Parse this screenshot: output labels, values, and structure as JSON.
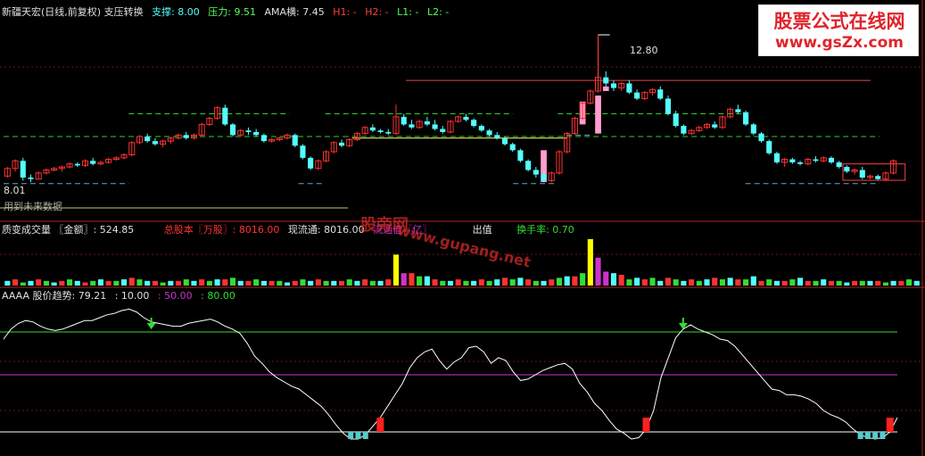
{
  "header1": {
    "title": "新疆天宏(日线,前复权) 支压转换",
    "support_label": "支撑: 8.00",
    "pressure_label": "压力: 9.51",
    "ama_label": "AMA横: 7.45",
    "h1_label": "H1: -",
    "h2_label": "H2: -",
    "l1_label": "L1: -",
    "l2_label": "L2: -"
  },
  "header2": {
    "title": "质变成交量 〖金额〗: 524.85",
    "total_shares": "总股本〖万股〗: 8016.00",
    "float_shares": "现流通: 8016.00",
    "float_value": "流通值〖亿〗",
    "chuzhi": "出值",
    "turnover": "换手率: 0.70"
  },
  "header3": {
    "title": "AAAA 股价趋势: 79.21",
    "l10": ": 10.00",
    "l50": ": 50.00",
    "l80": ": 80.00"
  },
  "price_labels": {
    "high": "12.80",
    "low": "8.01",
    "future": "用到未来数据"
  },
  "logo": {
    "line1": "股票公式在线网",
    "line2": "www.gsZx.com"
  },
  "watermark": {
    "cn": "股旁网",
    "url": "www.gupang.net"
  },
  "colors": {
    "up": "#ff3232",
    "down": "#54ffff",
    "support": "#33cc33",
    "pressure": "#3cb371",
    "level80": "#33dd33",
    "level50": "#cc33cc",
    "level10": "#ffffff",
    "trend": "#ffffff"
  },
  "chart_data": [
    {
      "type": "candlestick",
      "title": "新疆天宏(日线,前复权) 支压转换",
      "ylim": [
        7.6,
        13.3
      ],
      "ohlc": [
        [
          8.15,
          8.45,
          8.1,
          8.4
        ],
        [
          8.4,
          8.7,
          8.3,
          8.65
        ],
        [
          8.65,
          8.75,
          8.0,
          8.1
        ],
        [
          8.1,
          8.2,
          7.95,
          8.05
        ],
        [
          8.05,
          8.3,
          8.05,
          8.25
        ],
        [
          8.25,
          8.4,
          8.2,
          8.35
        ],
        [
          8.35,
          8.45,
          8.3,
          8.4
        ],
        [
          8.4,
          8.5,
          8.3,
          8.45
        ],
        [
          8.45,
          8.6,
          8.4,
          8.55
        ],
        [
          8.55,
          8.6,
          8.45,
          8.5
        ],
        [
          8.5,
          8.7,
          8.45,
          8.65
        ],
        [
          8.65,
          8.75,
          8.5,
          8.55
        ],
        [
          8.55,
          8.65,
          8.5,
          8.6
        ],
        [
          8.6,
          8.75,
          8.55,
          8.7
        ],
        [
          8.7,
          8.8,
          8.65,
          8.75
        ],
        [
          8.75,
          8.9,
          8.7,
          8.85
        ],
        [
          8.85,
          9.3,
          8.8,
          9.25
        ],
        [
          9.25,
          9.5,
          9.2,
          9.45
        ],
        [
          9.45,
          9.55,
          9.25,
          9.3
        ],
        [
          9.3,
          9.4,
          9.15,
          9.2
        ],
        [
          9.2,
          9.35,
          9.1,
          9.3
        ],
        [
          9.3,
          9.45,
          9.2,
          9.4
        ],
        [
          9.4,
          9.55,
          9.35,
          9.5
        ],
        [
          9.5,
          9.6,
          9.35,
          9.4
        ],
        [
          9.4,
          9.55,
          9.35,
          9.5
        ],
        [
          9.5,
          9.9,
          9.45,
          9.85
        ],
        [
          9.85,
          10.1,
          9.8,
          10.05
        ],
        [
          10.05,
          10.45,
          10.0,
          10.4
        ],
        [
          10.4,
          10.5,
          9.8,
          9.85
        ],
        [
          9.85,
          9.9,
          9.45,
          9.5
        ],
        [
          9.5,
          9.7,
          9.45,
          9.65
        ],
        [
          9.65,
          9.75,
          9.5,
          9.6
        ],
        [
          9.6,
          9.7,
          9.45,
          9.5
        ],
        [
          9.5,
          9.55,
          9.25,
          9.3
        ],
        [
          9.3,
          9.4,
          9.25,
          9.35
        ],
        [
          9.35,
          9.45,
          9.3,
          9.4
        ],
        [
          9.4,
          9.55,
          9.35,
          9.5
        ],
        [
          9.5,
          9.55,
          9.1,
          9.15
        ],
        [
          9.15,
          9.2,
          8.7,
          8.75
        ],
        [
          8.75,
          8.8,
          8.35,
          8.4
        ],
        [
          8.4,
          8.7,
          8.35,
          8.65
        ],
        [
          8.65,
          9.0,
          8.6,
          8.95
        ],
        [
          8.95,
          9.3,
          8.9,
          9.25
        ],
        [
          9.25,
          9.35,
          9.1,
          9.15
        ],
        [
          9.15,
          9.4,
          9.1,
          9.35
        ],
        [
          9.35,
          9.6,
          9.3,
          9.55
        ],
        [
          9.55,
          9.8,
          9.5,
          9.75
        ],
        [
          9.75,
          9.85,
          9.6,
          9.65
        ],
        [
          9.65,
          9.7,
          9.55,
          9.6
        ],
        [
          9.6,
          9.7,
          9.5,
          9.55
        ],
        [
          9.55,
          10.5,
          9.5,
          10.1
        ],
        [
          10.1,
          10.2,
          9.8,
          9.85
        ],
        [
          9.85,
          10.0,
          9.7,
          9.75
        ],
        [
          9.75,
          10.0,
          9.7,
          9.95
        ],
        [
          9.95,
          10.1,
          9.8,
          9.85
        ],
        [
          9.85,
          10.0,
          9.65,
          9.7
        ],
        [
          9.7,
          9.8,
          9.55,
          9.6
        ],
        [
          9.6,
          10.0,
          9.55,
          9.95
        ],
        [
          9.95,
          10.15,
          9.9,
          10.1
        ],
        [
          10.1,
          10.2,
          9.95,
          10.0
        ],
        [
          10.0,
          10.05,
          9.75,
          9.8
        ],
        [
          9.8,
          9.85,
          9.6,
          9.65
        ],
        [
          9.65,
          9.7,
          9.45,
          9.5
        ],
        [
          9.5,
          9.6,
          9.35,
          9.4
        ],
        [
          9.4,
          9.45,
          9.15,
          9.2
        ],
        [
          9.2,
          9.25,
          8.95,
          9.0
        ],
        [
          9.0,
          9.05,
          8.6,
          8.65
        ],
        [
          8.65,
          8.7,
          8.3,
          8.35
        ],
        [
          8.35,
          8.45,
          8.1,
          8.2
        ],
        [
          8.2,
          8.3,
          7.95,
          8.0
        ],
        [
          8.0,
          8.3,
          7.95,
          8.25
        ],
        [
          8.25,
          9.0,
          8.2,
          8.95
        ],
        [
          8.95,
          9.6,
          8.9,
          9.55
        ],
        [
          9.55,
          10.1,
          9.5,
          10.05
        ],
        [
          10.05,
          10.6,
          10.0,
          10.55
        ],
        [
          10.55,
          11.0,
          10.5,
          10.95
        ],
        [
          10.95,
          12.8,
          10.9,
          11.4
        ],
        [
          11.4,
          11.6,
          11.1,
          11.2
        ],
        [
          11.2,
          11.3,
          10.95,
          11.05
        ],
        [
          11.05,
          11.25,
          10.95,
          11.2
        ],
        [
          11.2,
          11.3,
          10.85,
          10.9
        ],
        [
          10.9,
          11.0,
          10.65,
          10.7
        ],
        [
          10.7,
          10.95,
          10.65,
          10.9
        ],
        [
          10.9,
          11.05,
          10.8,
          11.0
        ],
        [
          11.0,
          11.1,
          10.65,
          10.7
        ],
        [
          10.7,
          10.8,
          10.15,
          10.2
        ],
        [
          10.2,
          10.3,
          9.75,
          9.8
        ],
        [
          9.8,
          9.85,
          9.5,
          9.55
        ],
        [
          9.55,
          9.7,
          9.5,
          9.65
        ],
        [
          9.65,
          9.8,
          9.6,
          9.75
        ],
        [
          9.75,
          9.9,
          9.7,
          9.85
        ],
        [
          9.85,
          9.95,
          9.7,
          9.75
        ],
        [
          9.75,
          10.15,
          9.7,
          10.1
        ],
        [
          10.1,
          10.4,
          10.05,
          10.35
        ],
        [
          10.35,
          10.5,
          10.2,
          10.25
        ],
        [
          10.25,
          10.3,
          9.8,
          9.85
        ],
        [
          9.85,
          9.9,
          9.5,
          9.55
        ],
        [
          9.55,
          9.6,
          9.25,
          9.3
        ],
        [
          9.3,
          9.35,
          8.85,
          8.9
        ],
        [
          8.9,
          8.95,
          8.55,
          8.6
        ],
        [
          8.6,
          8.75,
          8.45,
          8.7
        ],
        [
          8.7,
          8.75,
          8.55,
          8.6
        ],
        [
          8.6,
          8.65,
          8.5,
          8.55
        ],
        [
          8.55,
          8.75,
          8.5,
          8.7
        ],
        [
          8.7,
          8.8,
          8.6,
          8.65
        ],
        [
          8.65,
          8.8,
          8.6,
          8.75
        ],
        [
          8.75,
          8.8,
          8.55,
          8.6
        ],
        [
          8.6,
          8.65,
          8.4,
          8.45
        ],
        [
          8.45,
          8.5,
          8.25,
          8.3
        ],
        [
          8.3,
          8.4,
          8.2,
          8.35
        ],
        [
          8.35,
          8.45,
          8.05,
          8.1
        ],
        [
          8.1,
          8.2,
          8.05,
          8.15
        ],
        [
          8.15,
          8.2,
          8.0,
          8.05
        ],
        [
          8.05,
          8.3,
          8.01,
          8.25
        ],
        [
          8.25,
          8.7,
          8.2,
          8.65
        ]
      ],
      "pink_bars": [
        [
          69,
          7.95,
          9.0
        ],
        [
          74,
          9.85,
          10.6
        ],
        [
          76,
          9.55,
          10.8
        ],
        [
          77,
          10.95,
          11.1
        ]
      ],
      "support_pressure_lines": [
        {
          "color": "#33cc33",
          "y": 10.2,
          "x0": 0.14,
          "x1": 0.32
        },
        {
          "color": "#33cc33",
          "y": 9.45,
          "x0": 0.0,
          "x1": 0.38
        },
        {
          "color": "#33cc33",
          "y": 10.2,
          "x0": 0.36,
          "x1": 0.57
        },
        {
          "color": "#33cc33",
          "y": 9.45,
          "x0": 0.38,
          "x1": 0.62
        },
        {
          "color": "#33cc33",
          "y": 10.2,
          "x0": 0.62,
          "x1": 0.83
        },
        {
          "color": "#33cc33",
          "y": 9.45,
          "x0": 0.62,
          "x1": 0.98
        },
        {
          "color": "#e64646",
          "y": 11.3,
          "x0": 0.45,
          "x1": 0.97
        },
        {
          "color": "#6fa0d0",
          "y": 7.9,
          "x0": 0.0,
          "x1": 0.14
        },
        {
          "color": "#6fa0d0",
          "y": 7.9,
          "x0": 0.33,
          "x1": 0.36
        },
        {
          "color": "#6fa0d0",
          "y": 7.9,
          "x0": 0.57,
          "x1": 0.62
        },
        {
          "color": "#6fa0d0",
          "y": 7.9,
          "x0": 0.83,
          "x1": 0.98
        },
        {
          "color": "#6fa0d0",
          "y": 9.5,
          "x0": 0.63,
          "x1": 0.66
        },
        {
          "color": "#ffff66",
          "y": 9.4,
          "x0": 0.39,
          "x1": 0.63
        }
      ]
    },
    {
      "type": "bar",
      "title": "质变成交量 〖金额〗: 524.85",
      "values": [
        3,
        4,
        2,
        3,
        4,
        3,
        2,
        3,
        4,
        3,
        2,
        3,
        4,
        3,
        3,
        4,
        5,
        4,
        3,
        3,
        2,
        3,
        3,
        4,
        3,
        4,
        3,
        4,
        4,
        5,
        3,
        3,
        4,
        3,
        3,
        3,
        2,
        3,
        4,
        3,
        4,
        3,
        3,
        3,
        4,
        3,
        4,
        3,
        3,
        4,
        20,
        8,
        8,
        6,
        6,
        4,
        3,
        3,
        4,
        3,
        3,
        4,
        3,
        4,
        5,
        4,
        5,
        4,
        3,
        3,
        4,
        5,
        6,
        6,
        8,
        30,
        18,
        9,
        8,
        7,
        4,
        5,
        4,
        5,
        3,
        5,
        4,
        3,
        4,
        3,
        4,
        5,
        4,
        5,
        4,
        4,
        6,
        3,
        4,
        3,
        3,
        4,
        5,
        3,
        3,
        4,
        3,
        3,
        2,
        3,
        3,
        3,
        3,
        2,
        3,
        3,
        4,
        3
      ],
      "highlights": {
        "50": "#ffff00",
        "75": "#ffff00",
        "51": "#cc33cc",
        "76": "#cc33cc",
        "77": "#cc33cc"
      }
    },
    {
      "type": "line",
      "title": "AAAA 股价趋势: 79.21",
      "ylim": [
        0,
        100
      ],
      "levels": [
        80,
        50,
        10
      ],
      "values": [
        75,
        82,
        86,
        88,
        87,
        84,
        82,
        81,
        82,
        84,
        86,
        88,
        88,
        90,
        92,
        93,
        95,
        96,
        94,
        90,
        87,
        86,
        85,
        84,
        84,
        86,
        87,
        88,
        89,
        87,
        84,
        82,
        79,
        72,
        63,
        58,
        52,
        48,
        45,
        42,
        40,
        36,
        32,
        28,
        22,
        15,
        9,
        5,
        5,
        8,
        14,
        20,
        28,
        36,
        44,
        55,
        62,
        66,
        68,
        60,
        54,
        59,
        62,
        69,
        70,
        66,
        58,
        62,
        60,
        52,
        46,
        47,
        50,
        53,
        55,
        57,
        58,
        54,
        44,
        38,
        30,
        25,
        18,
        12,
        9,
        5,
        6,
        12,
        25,
        48,
        62,
        76,
        82,
        85,
        82,
        80,
        78,
        75,
        74,
        70,
        64,
        58,
        52,
        46,
        40,
        39,
        36,
        36,
        35,
        33,
        30,
        25,
        22,
        20,
        17,
        12,
        8,
        6,
        5,
        6,
        10,
        20
      ]
    }
  ]
}
